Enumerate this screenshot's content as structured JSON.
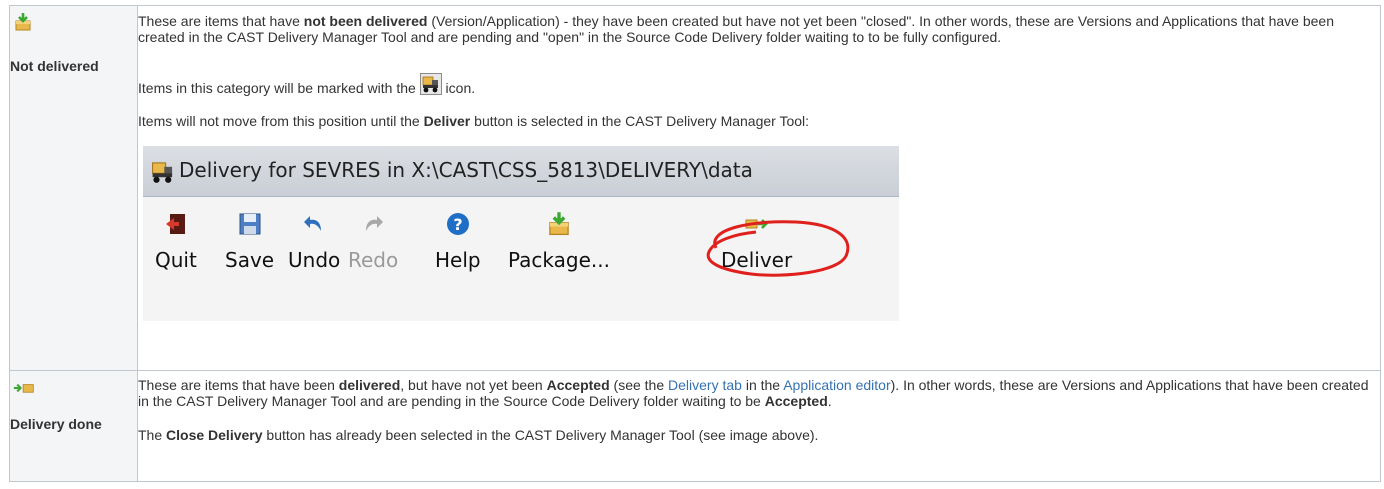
{
  "rows": [
    {
      "label": "Not delivered",
      "icon": "package-download-icon",
      "para1": {
        "t1": "These are items that have ",
        "b1": "not been delivered",
        "t2": " (Version/Application) - they have been created but have not yet been \"closed\". In other words, these are Versions and Applications that have been created in the CAST Delivery Manager Tool and are pending and \"open\" in the Source Code Delivery folder waiting to to be fully configured."
      },
      "para2": {
        "t1": "Items in this category will be marked with the ",
        "t2": " icon."
      },
      "para3": {
        "t1": "Items will not move from this position until the ",
        "b1": "Deliver",
        "t2": " button is selected in the CAST Delivery Manager Tool:"
      },
      "screenshot": {
        "title": "Delivery for SEVRES in X:\\CAST\\CSS_5813\\DELIVERY\\data",
        "buttons": [
          {
            "label": "Quit",
            "icon": "quit-icon"
          },
          {
            "label": "Save",
            "icon": "save-icon"
          },
          {
            "label": "Undo",
            "icon": "undo-icon"
          },
          {
            "label": "Redo",
            "icon": "redo-icon"
          },
          {
            "label": "Help",
            "icon": "help-icon"
          },
          {
            "label": "Package...",
            "icon": "package-icon"
          },
          {
            "label": "Deliver",
            "icon": "deliver-icon"
          }
        ]
      }
    },
    {
      "label": "Delivery done",
      "icon": "delivery-done-icon",
      "para1": {
        "t1": "These are items that have been ",
        "b1": "delivered",
        "t2": ", but have not yet been ",
        "b2": "Accepted",
        "t3": " (see the ",
        "link1": "Delivery tab",
        "t4": " in the ",
        "link2": "Application editor",
        "t5": "). In other words, these are Versions and Applications that have been created in the CAST Delivery Manager Tool and are pending in the Source Code Delivery folder waiting to be ",
        "b3": "Accepted",
        "t6": "."
      },
      "para2": {
        "t1": "The ",
        "b1": "Close Delivery",
        "t2": " button has already been selected in the CAST Delivery Manager Tool (see image above)."
      }
    }
  ],
  "colors": {
    "link": "#3572b0",
    "border": "#c1c7d0",
    "label_bg": "#f4f5f7",
    "oval": "#e0201c"
  }
}
